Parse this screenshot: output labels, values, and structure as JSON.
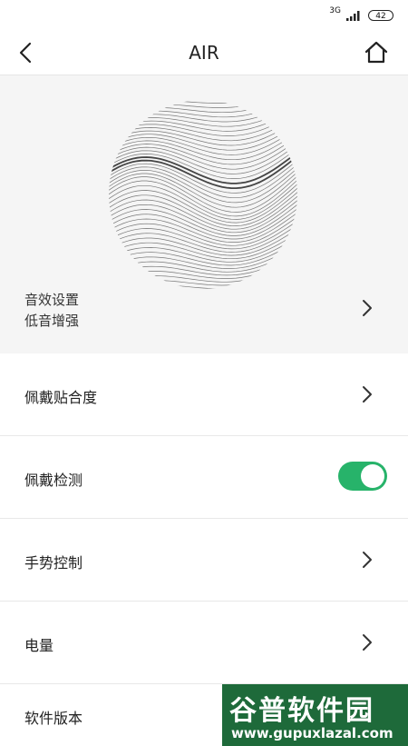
{
  "status_bar": {
    "network": "3G",
    "battery": "42"
  },
  "header": {
    "title": "AIR"
  },
  "hero": {
    "sound_label": "音效设置",
    "sound_value": "低音增强"
  },
  "settings": [
    {
      "label": "佩戴贴合度",
      "control": "chevron"
    },
    {
      "label": "佩戴检测",
      "control": "toggle",
      "enabled": true
    },
    {
      "label": "手势控制",
      "control": "chevron"
    },
    {
      "label": "电量",
      "control": "chevron"
    },
    {
      "label": "软件版本",
      "control": "none"
    }
  ],
  "watermark": {
    "cn": "谷普软件园",
    "url": "www.gupuxlazal.com"
  },
  "colors": {
    "toggle_on": "#27b36a",
    "hero_bg": "#f5f5f5"
  }
}
